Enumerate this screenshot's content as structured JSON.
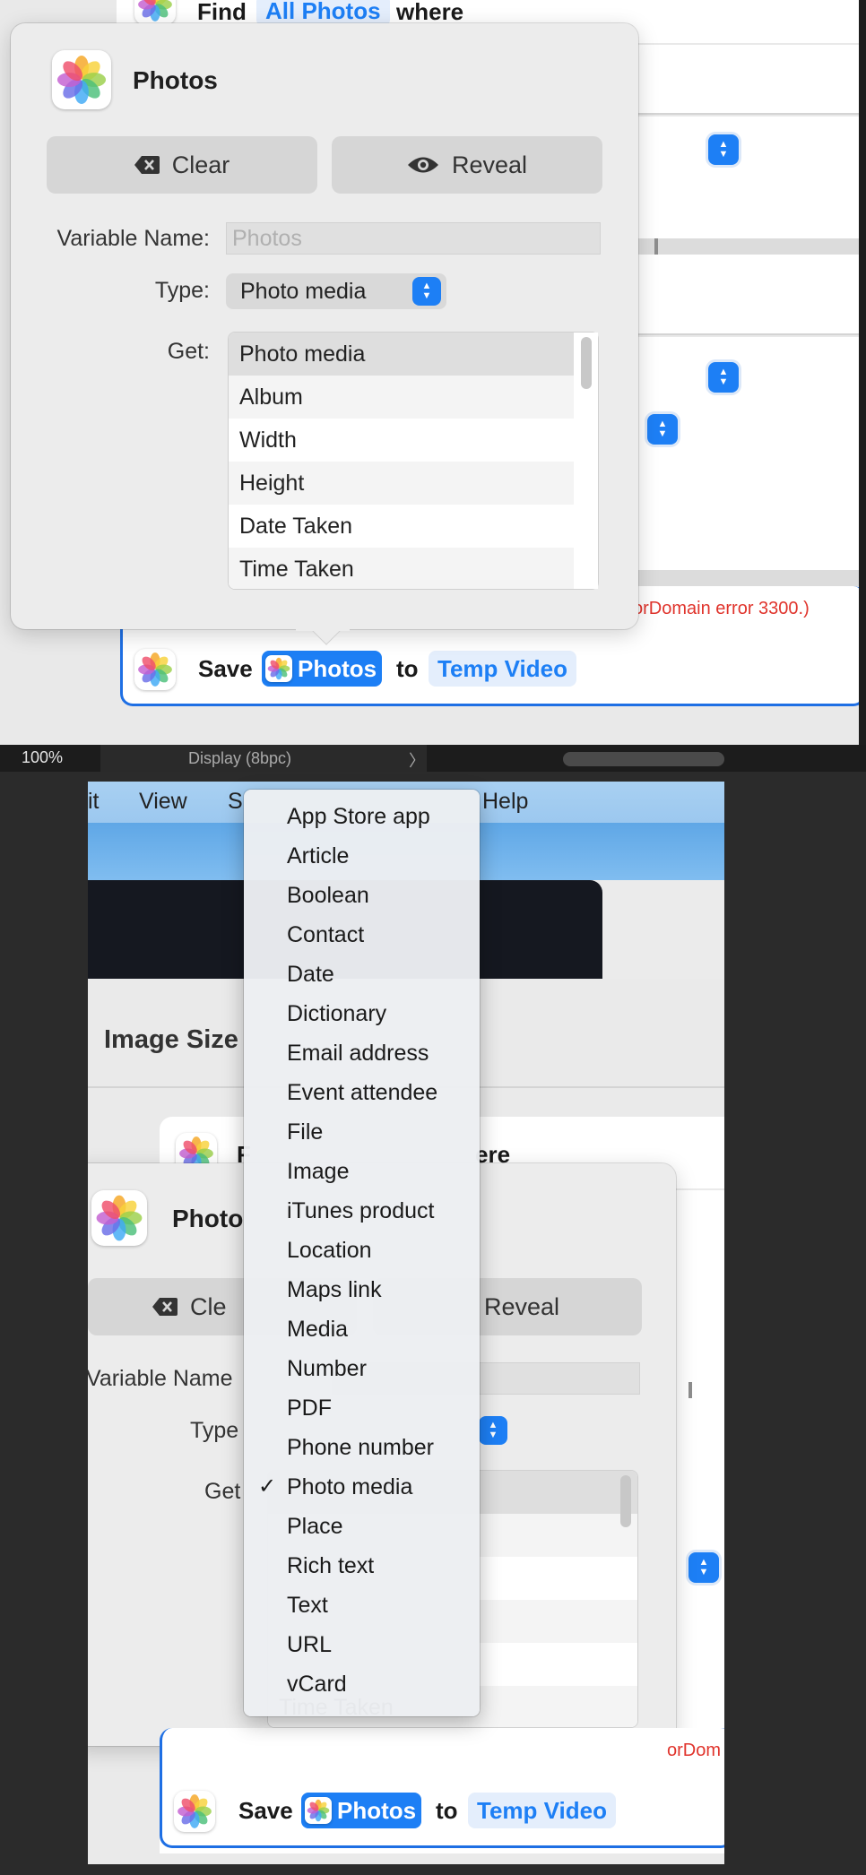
{
  "top": {
    "find_row": {
      "find": "Find",
      "scope": "All Photos",
      "where": "where"
    },
    "popover": {
      "title": "Photos",
      "clear_label": "Clear",
      "reveal_label": "Reveal",
      "variable_name_label": "Variable Name:",
      "variable_name_placeholder": "Photos",
      "type_label": "Type:",
      "type_value": "Photo media",
      "get_label": "Get:",
      "get_items": [
        "Photo media",
        "Album",
        "Width",
        "Height",
        "Date Taken",
        "Time Taken"
      ],
      "get_selected": "Photo media"
    },
    "error_text": "orDomain error 3300.)",
    "save_action": {
      "save": "Save",
      "variable": "Photos",
      "to": "to",
      "destination": "Temp Video"
    }
  },
  "status_bar": {
    "zoom": "100%",
    "display": "Display (8bpc)",
    "chevron": "〉"
  },
  "bottom": {
    "menubar": {
      "edit_fragment": "it",
      "view": "View",
      "share_fragment": "S",
      "help": "Help"
    },
    "section_title": "Image Size",
    "find_row": {
      "find_fragment": "F",
      "where_fragment": "ere"
    },
    "popover": {
      "title_fragment": "Photo",
      "clear_fragment": "Cle",
      "reveal_label": "Reveal",
      "variable_name_fragment": "Variable Name",
      "type_fragment": "Type",
      "get_fragment": "Get",
      "hidden_row": "Time Taken"
    },
    "error_fragment": "orDom",
    "save_action": {
      "save": "Save",
      "variable": "Photos",
      "to": "to",
      "destination": "Temp Video"
    },
    "type_menu": {
      "items": [
        "App Store app",
        "Article",
        "Boolean",
        "Contact",
        "Date",
        "Dictionary",
        "Email address",
        "Event attendee",
        "File",
        "Image",
        "iTunes product",
        "Location",
        "Maps link",
        "Media",
        "Number",
        "PDF",
        "Phone number",
        "Photo media",
        "Place",
        "Rich text",
        "Text",
        "URL",
        "vCard"
      ],
      "checked": "Photo media",
      "check_mark": "✓"
    }
  },
  "colors": {
    "accent": "#1d7ff5",
    "error": "#e0342c"
  },
  "icons": [
    "photos-app-icon",
    "clear-icon",
    "eye-icon",
    "stepper-icon",
    "checkmark-icon"
  ]
}
